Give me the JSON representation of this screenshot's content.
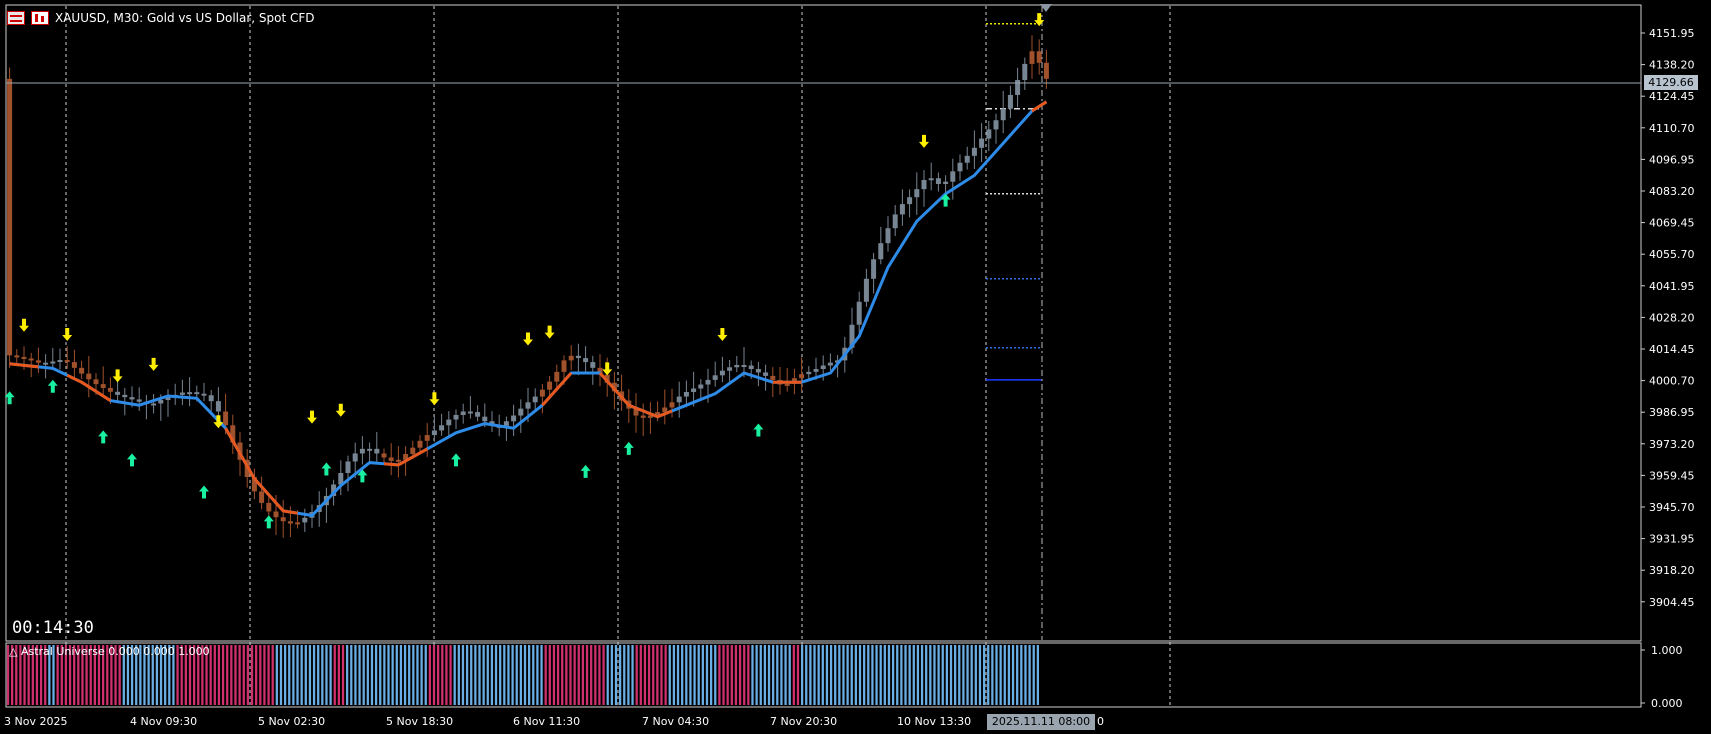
{
  "window": {
    "title": "XAUUSD, M30:  Gold vs US Dollar, Spot CFD",
    "countdown": "00:14:30"
  },
  "colors": {
    "bull": "#2e8be8",
    "bear": "#e8571c",
    "up_arrow": "#19f0a0",
    "down_arrow": "#ffee00",
    "candle": "#788592",
    "ind_pink": "#d0306e",
    "ind_blue": "#6aaee6",
    "grid": "#cfcfcf"
  },
  "price_axis": {
    "labels": [
      "4151.95",
      "4138.20",
      "4124.45",
      "4110.70",
      "4096.95",
      "4083.20",
      "4069.45",
      "4055.70",
      "4041.95",
      "4028.20",
      "4014.45",
      "4000.70",
      "3986.95",
      "3973.20",
      "3959.45",
      "3945.70",
      "3931.95",
      "3918.20",
      "3904.45"
    ],
    "current_price": "4129.66"
  },
  "time_axis": {
    "labels": [
      "3 Nov 2025",
      "4 Nov 09:30",
      "5 Nov 02:30",
      "5 Nov 18:30",
      "6 Nov 11:30",
      "7 Nov 04:30",
      "7 Nov 20:30",
      "10 Nov 13:30"
    ],
    "cursor_time": "2025.11.11 08:00",
    "cursor_tail": "0"
  },
  "indicator": {
    "label": "△ Astral Universe 0.000 0.000 1.000",
    "levels": [
      "1.000",
      "0.000"
    ],
    "segments": [
      {
        "state": "pink",
        "count": 10
      },
      {
        "state": "blue",
        "count": 2
      },
      {
        "state": "pink",
        "count": 16
      },
      {
        "state": "blue",
        "count": 7
      },
      {
        "state": "blue",
        "count": 6
      },
      {
        "state": "pink",
        "count": 24
      },
      {
        "state": "blue",
        "count": 14
      },
      {
        "state": "pink",
        "count": 3
      },
      {
        "state": "blue",
        "count": 20
      },
      {
        "state": "pink",
        "count": 6
      },
      {
        "state": "blue",
        "count": 22
      },
      {
        "state": "pink",
        "count": 15
      },
      {
        "state": "blue",
        "count": 7
      },
      {
        "state": "pink",
        "count": 8
      },
      {
        "state": "blue",
        "count": 12
      },
      {
        "state": "pink",
        "count": 8
      },
      {
        "state": "blue",
        "count": 10
      },
      {
        "state": "pink",
        "count": 2
      },
      {
        "state": "blue",
        "count": 58
      }
    ]
  },
  "chart_data": {
    "type": "line",
    "symbol": "XAUUSD",
    "timeframe": "M30",
    "ylim": [
      3894,
      4162
    ],
    "x": [
      "3 Nov 2025",
      "4 Nov 09:30",
      "5 Nov 02:30",
      "5 Nov 18:30",
      "6 Nov 11:30",
      "7 Nov 04:30",
      "7 Nov 20:30",
      "10 Nov 13:30",
      "2025.11.11 08:00"
    ],
    "price_path": [
      [
        0,
        4012
      ],
      [
        3,
        4010
      ],
      [
        5,
        4008
      ],
      [
        8,
        4010
      ],
      [
        10,
        4005
      ],
      [
        12,
        4000
      ],
      [
        15,
        3995
      ],
      [
        18,
        3992
      ],
      [
        20,
        3990
      ],
      [
        22,
        3993
      ],
      [
        25,
        3996
      ],
      [
        28,
        3994
      ],
      [
        30,
        3985
      ],
      [
        32,
        3970
      ],
      [
        34,
        3955
      ],
      [
        36,
        3945
      ],
      [
        38,
        3940
      ],
      [
        40,
        3938
      ],
      [
        42,
        3942
      ],
      [
        44,
        3948
      ],
      [
        46,
        3958
      ],
      [
        48,
        3968
      ],
      [
        50,
        3972
      ],
      [
        52,
        3968
      ],
      [
        54,
        3965
      ],
      [
        56,
        3970
      ],
      [
        58,
        3976
      ],
      [
        60,
        3980
      ],
      [
        62,
        3985
      ],
      [
        64,
        3988
      ],
      [
        66,
        3984
      ],
      [
        68,
        3980
      ],
      [
        70,
        3984
      ],
      [
        72,
        3990
      ],
      [
        74,
        3995
      ],
      [
        76,
        4002
      ],
      [
        78,
        4012
      ],
      [
        80,
        4010
      ],
      [
        82,
        4005
      ],
      [
        84,
        3998
      ],
      [
        86,
        3990
      ],
      [
        88,
        3984
      ],
      [
        90,
        3986
      ],
      [
        92,
        3990
      ],
      [
        94,
        3995
      ],
      [
        96,
        3998
      ],
      [
        98,
        4002
      ],
      [
        100,
        4006
      ],
      [
        102,
        4008
      ],
      [
        104,
        4005
      ],
      [
        106,
        4002
      ],
      [
        108,
        3998
      ],
      [
        110,
        4003
      ],
      [
        112,
        4005
      ],
      [
        114,
        4008
      ],
      [
        116,
        4010
      ],
      [
        118,
        4030
      ],
      [
        120,
        4050
      ],
      [
        122,
        4064
      ],
      [
        124,
        4076
      ],
      [
        126,
        4082
      ],
      [
        128,
        4090
      ],
      [
        130,
        4085
      ],
      [
        132,
        4094
      ],
      [
        134,
        4100
      ],
      [
        136,
        4108
      ],
      [
        138,
        4116
      ],
      [
        140,
        4128
      ],
      [
        142,
        4142
      ],
      [
        143,
        4146
      ],
      [
        144,
        4132
      ]
    ],
    "ema_path": [
      [
        0,
        4008
      ],
      [
        6,
        4006
      ],
      [
        10,
        4000
      ],
      [
        14,
        3992
      ],
      [
        18,
        3990
      ],
      [
        22,
        3994
      ],
      [
        26,
        3993
      ],
      [
        30,
        3980
      ],
      [
        34,
        3958
      ],
      [
        38,
        3944
      ],
      [
        42,
        3942
      ],
      [
        46,
        3955
      ],
      [
        50,
        3965
      ],
      [
        54,
        3964
      ],
      [
        58,
        3971
      ],
      [
        62,
        3978
      ],
      [
        66,
        3982
      ],
      [
        70,
        3980
      ],
      [
        74,
        3990
      ],
      [
        78,
        4004
      ],
      [
        82,
        4004
      ],
      [
        86,
        3990
      ],
      [
        90,
        3985
      ],
      [
        94,
        3990
      ],
      [
        98,
        3995
      ],
      [
        102,
        4004
      ],
      [
        106,
        4000
      ],
      [
        110,
        4000
      ],
      [
        114,
        4004
      ],
      [
        118,
        4020
      ],
      [
        122,
        4050
      ],
      [
        126,
        4070
      ],
      [
        130,
        4082
      ],
      [
        134,
        4090
      ],
      [
        138,
        4104
      ],
      [
        142,
        4118
      ],
      [
        144,
        4122
      ]
    ],
    "buy_signals": [
      [
        0,
        3993
      ],
      [
        6,
        3998
      ],
      [
        13,
        3976
      ],
      [
        17,
        3966
      ],
      [
        27,
        3952
      ],
      [
        36,
        3939
      ],
      [
        44,
        3962
      ],
      [
        49,
        3959
      ],
      [
        62,
        3966
      ],
      [
        80,
        3961
      ],
      [
        86,
        3971
      ],
      [
        104,
        3979
      ],
      [
        130,
        4079
      ]
    ],
    "sell_signals": [
      [
        2,
        4025
      ],
      [
        8,
        4021
      ],
      [
        15,
        4003
      ],
      [
        20,
        4008
      ],
      [
        29,
        3983
      ],
      [
        42,
        3985
      ],
      [
        46,
        3988
      ],
      [
        59,
        3993
      ],
      [
        72,
        4019
      ],
      [
        75,
        4022
      ],
      [
        83,
        4006
      ],
      [
        99,
        4021
      ],
      [
        127,
        4105
      ],
      [
        143,
        4158
      ]
    ],
    "levels": [
      {
        "price": 4156,
        "style": "yellow-dotted"
      },
      {
        "price": 4119,
        "style": "white-dashdot"
      },
      {
        "price": 4082,
        "style": "white-dotted"
      },
      {
        "price": 4045,
        "style": "blue-dotted"
      },
      {
        "price": 4015,
        "style": "blue-dotted"
      },
      {
        "price": 4001,
        "style": "blue-solid"
      }
    ],
    "grid": true
  }
}
